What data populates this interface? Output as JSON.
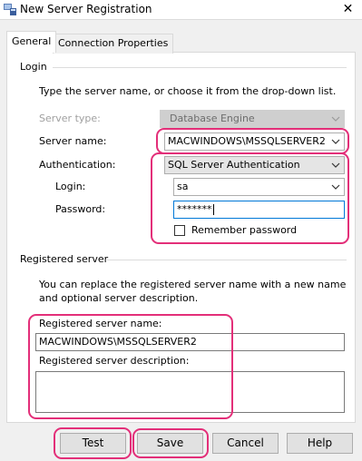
{
  "window": {
    "title": "New Server Registration",
    "close_glyph": "✕"
  },
  "tabs": [
    {
      "label": "General"
    },
    {
      "label": "Connection Properties"
    }
  ],
  "login_section": {
    "header": "Login",
    "instructions": "Type the server name, or choose it from the drop-down list.",
    "server_type": {
      "label": "Server type:",
      "value": "Database Engine"
    },
    "server_name": {
      "label": "Server name:",
      "value": "MACWINDOWS\\MSSQLSERVER2"
    },
    "authentication": {
      "label": "Authentication:",
      "value": "SQL Server Authentication"
    },
    "login": {
      "label": "Login:",
      "value": "sa"
    },
    "password": {
      "label": "Password:",
      "value": "*******"
    },
    "remember_password": {
      "label": "Remember password",
      "checked": false
    }
  },
  "registered_section": {
    "header": "Registered server",
    "description_line1": "You can replace the registered server name with a new name",
    "description_line2": "and optional server description.",
    "name": {
      "label": "Registered server name:",
      "value": "MACWINDOWS\\MSSQLSERVER2"
    },
    "description": {
      "label": "Registered server description:",
      "value": ""
    }
  },
  "buttons": {
    "test": "Test",
    "save": "Save",
    "cancel": "Cancel",
    "help": "Help"
  },
  "colors": {
    "highlight": "#e32f79",
    "focus": "#0078d7",
    "panel": "#ffffff",
    "window": "#f0f0f0"
  },
  "icons": {
    "app": "server-registration-icon",
    "dropdown": "chevron-down-icon",
    "close": "close-icon"
  }
}
